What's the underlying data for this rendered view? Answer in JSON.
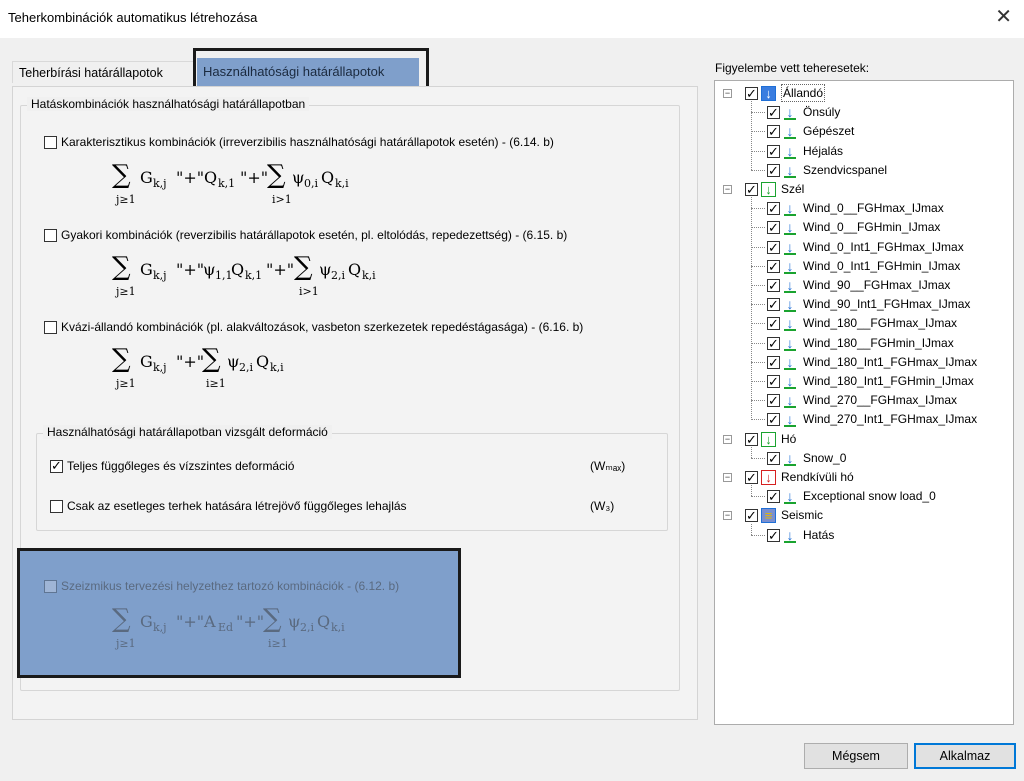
{
  "window": {
    "title": "Teherkombinációk automatikus létrehozása",
    "close": "✕"
  },
  "tabs": [
    {
      "label": "Teherbírási határállapotok"
    },
    {
      "label": "Használhatósági határállapotok"
    }
  ],
  "panel": {
    "group_title": "Hatáskombinációk használhatósági határállapotban",
    "options": [
      {
        "label": "Karakterisztikus kombinációk (irreverzibilis használhatósági határállapotok esetén) - (6.14. b)",
        "checked": false
      },
      {
        "label": "Gyakori kombinációk (reverzibilis határállapotok esetén, pl. eltolódás, repedezettség) - (6.15. b)",
        "checked": false
      },
      {
        "label": "Kvázi-állandó kombinációk (pl. alakváltozások, vasbeton szerkezetek repedéstágasága) - (6.16. b)",
        "checked": false
      }
    ],
    "deform_group_title": "Használhatósági határállapotban vizsgált deformáció",
    "deform_options": [
      {
        "label": "Teljes függőleges és vízszintes deformáció",
        "symbol": "(Wₘₐₓ)",
        "checked": true
      },
      {
        "label": "Csak az esetleges terhek hatására létrejövő függőleges lehajlás",
        "symbol": "(W₃)",
        "checked": false
      }
    ],
    "seismic": {
      "label": "Szeizmikus tervezési helyzethez tartozó kombinációk - (6.12. b)",
      "checked": false
    }
  },
  "formulas": {
    "f1": {
      "a": "G",
      "a_sub": "k,j",
      "plus1": "\"+\"",
      "b": "Q",
      "b_sub": "k,1",
      "plus2": "\"+\"",
      "c": "ψ",
      "c_sub": "0,i",
      "d": "Q",
      "d_sub": "k,i",
      "s1": "j≥1",
      "s2": "i>1"
    },
    "f2": {
      "a": "G",
      "a_sub": "k,j",
      "plus1": "\"+\"",
      "b": "ψ",
      "b_sub": "1,1",
      "b2": "Q",
      "b2_sub": "k,1",
      "plus2": "\"+\"",
      "c": "ψ",
      "c_sub": "2,i",
      "d": "Q",
      "d_sub": "k,i",
      "s1": "j≥1",
      "s2": "i>1"
    },
    "f3": {
      "a": "G",
      "a_sub": "k,j",
      "plus1": "\"+\"",
      "c": "ψ",
      "c_sub": "2,i",
      "d": "Q",
      "d_sub": "k,i",
      "s1": "j≥1",
      "s2": "i≥1"
    },
    "f4": {
      "a": "G",
      "a_sub": "k,j",
      "plus1": "\"+\"",
      "b": "A",
      "b_sub": "Ed",
      "plus2": "\"+\"",
      "c": "ψ",
      "c_sub": "2,i",
      "d": "Q",
      "d_sub": "k,i",
      "s1": "j≥1",
      "s2": "i≥1"
    },
    "sigma": "∑"
  },
  "tree": {
    "title": "Figyelembe vett teheresetek:",
    "groups": [
      {
        "label": "Állandó",
        "color": "#1f6fd6",
        "items": [
          "Önsúly",
          "Gépészet",
          "Héjalás",
          "Szendvicspanel"
        ]
      },
      {
        "label": "Szél",
        "color": "#1aa32f",
        "items": [
          "Wind_0__FGHmax_IJmax",
          "Wind_0__FGHmin_IJmax",
          "Wind_0_Int1_FGHmax_IJmax",
          "Wind_0_Int1_FGHmin_IJmax",
          "Wind_90__FGHmax_IJmax",
          "Wind_90_Int1_FGHmax_IJmax",
          "Wind_180__FGHmax_IJmax",
          "Wind_180__FGHmin_IJmax",
          "Wind_180_Int1_FGHmax_IJmax",
          "Wind_180_Int1_FGHmin_IJmax",
          "Wind_270__FGHmax_IJmax",
          "Wind_270_Int1_FGHmax_IJmax"
        ]
      },
      {
        "label": "Hó",
        "color": "#1aa32f",
        "items": [
          "Snow_0"
        ]
      },
      {
        "label": "Rendkívüli hó",
        "color": "#d62020",
        "items": [
          "Exceptional snow load_0"
        ]
      },
      {
        "label": "Seismic",
        "color": "#1f6fd6",
        "items": [
          "Hatás"
        ]
      }
    ]
  },
  "buttons": {
    "cancel": "Mégsem",
    "ok": "Alkalmaz"
  }
}
